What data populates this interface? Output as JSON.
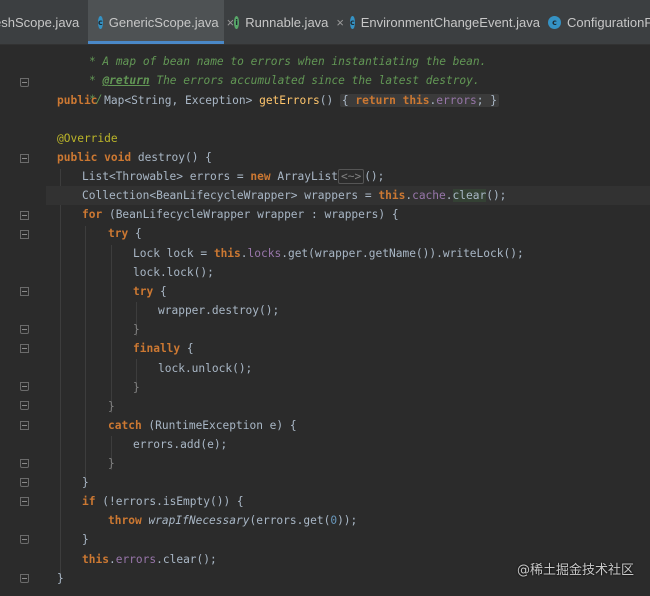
{
  "tabs": [
    {
      "label": "eshScope.java",
      "icon": "java-class-icon",
      "icon_color": "#3592c4",
      "active": false
    },
    {
      "label": "GenericScope.java",
      "icon": "java-class-icon",
      "icon_color": "#3592c4",
      "active": true
    },
    {
      "label": "Runnable.java",
      "icon": "java-interface-icon",
      "icon_color": "#59a869",
      "active": false
    },
    {
      "label": "EnvironmentChangeEvent.java",
      "icon": "java-class-icon",
      "icon_color": "#3592c4",
      "active": false
    },
    {
      "label": "ConfigurationPro",
      "icon": "java-class-icon",
      "icon_color": "#3592c4",
      "active": false
    }
  ],
  "tab_close_glyph": "×",
  "tab_icon_letters": {
    "class": "c",
    "interface": "i"
  },
  "code": {
    "l1": "* A map of bean name to errors when instantiating the bean.",
    "l2_tag": "@return",
    "l2_text": " The errors accumulated since the latest destroy.",
    "l3": "*/",
    "l4a": "public",
    "l4b": " Map<String, Exception> ",
    "l4c": "getErrors",
    "l4d": "() ",
    "l4e": "{ ",
    "l4f": "return",
    "l4g": " ",
    "l4h": "this",
    "l4i": ".",
    "l4j": "errors",
    "l4k": "; ",
    "l4l": "}",
    "l6": "@Override",
    "l7a": "public void",
    "l7b": " destroy() {",
    "l8a": "List<Throwable> errors = ",
    "l8b": "new",
    "l8c": " ArrayList",
    "l8d": "<~>",
    "l8e": "();",
    "l9a": "Collection<BeanLifecycleWrapper> wrappers = ",
    "l9b": "this",
    "l9c": ".",
    "l9d": "cache",
    "l9e": ".",
    "l9f": "clear",
    "l9g": "();",
    "l10a": "for",
    "l10b": " (BeanLifecycleWrapper wrapper : wrappers) {",
    "l11a": "try",
    "l11b": " {",
    "l12a": "Lock lock = ",
    "l12b": "this",
    "l12c": ".",
    "l12d": "locks",
    "l12e": ".get(wrapper.getName()).writeLock();",
    "l13": "lock.lock();",
    "l14a": "try",
    "l14b": " {",
    "l15": "wrapper.destroy();",
    "l16": "}",
    "l17a": "finally",
    "l17b": " {",
    "l18": "lock.unlock();",
    "l19": "}",
    "l20": "}",
    "l21a": "catch",
    "l21b": " (RuntimeException e) {",
    "l22": "errors.add(e);",
    "l23": "}",
    "l24": "}",
    "l25a": "if",
    "l25b": " (!errors.isEmpty()) {",
    "l26a": "throw",
    "l26b": " ",
    "l26c": "wrapIfNecessary",
    "l26d": "(errors.get(",
    "l26e": "0",
    "l26f": "));",
    "l27": "}",
    "l28a": "this",
    "l28b": ".",
    "l28c": "errors",
    "l28d": ".clear();",
    "l29": "}"
  },
  "watermark": "@稀土掘金技术社区",
  "colors": {
    "keyword": "#cc7832",
    "annotation": "#bbb529",
    "field": "#9876aa",
    "comment": "#629755",
    "number": "#6897bb",
    "background": "#2b2b2b"
  }
}
